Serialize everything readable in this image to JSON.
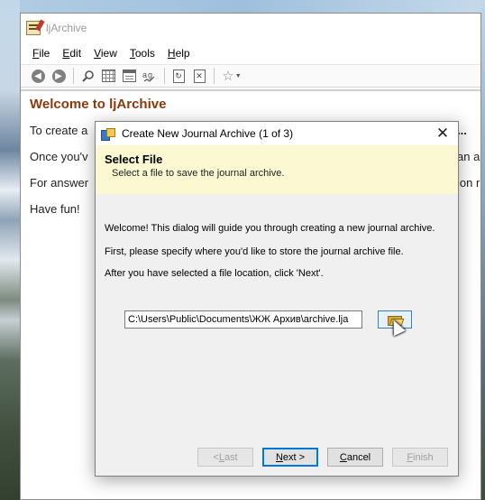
{
  "app": {
    "title": "ljArchive"
  },
  "menu": {
    "items": [
      {
        "label_u": "F",
        "label_rest": "ile"
      },
      {
        "label_u": "E",
        "label_rest": "dit"
      },
      {
        "label_u": "V",
        "label_rest": "iew"
      },
      {
        "label_u": "T",
        "label_rest": "ools"
      },
      {
        "label_u": "H",
        "label_rest": "elp"
      }
    ]
  },
  "toolbar": {
    "icons": [
      "back-icon",
      "forward-icon",
      "search-icon",
      "calendar-grid-icon",
      "calendar-icon",
      "spellcheck-icon",
      "refresh-doc-icon",
      "close-doc-icon",
      "favorites-star-icon"
    ]
  },
  "content": {
    "heading": "Welcome to ljArchive",
    "line1_left": "To create a",
    "line1_right": "ive...",
    "line2_left": "Once you'v",
    "line2_right": "an a",
    "line3_left": "For answer",
    "line3_right": "ion r",
    "line4_left": "Have fun!"
  },
  "dialog": {
    "title": "Create New Journal Archive (1 of 3)",
    "header_title": "Select File",
    "header_subtitle": "Select a file to save the journal archive.",
    "text1": "Welcome!  This dialog will guide you through creating a new journal archive.",
    "text2": "First, please specify where you'd like to store the journal archive file.",
    "text3": "After you have selected a file location, click 'Next'.",
    "path_value": "C:\\Users\\Public\\Documents\\ЖЖ Архив\\archive.lja",
    "buttons": {
      "last": {
        "u": "L",
        "pre": "< ",
        "rest": "ast"
      },
      "next": {
        "u": "N",
        "pre": "",
        "rest": "ext >"
      },
      "cancel": {
        "u": "C",
        "pre": "",
        "rest": "ancel"
      },
      "finish": {
        "u": "F",
        "pre": "",
        "rest": "inish"
      }
    }
  },
  "colors": {
    "heading": "#8b3a0e",
    "dialog_header_bg": "#fbf8d2",
    "default_button_border": "#0078d7"
  }
}
